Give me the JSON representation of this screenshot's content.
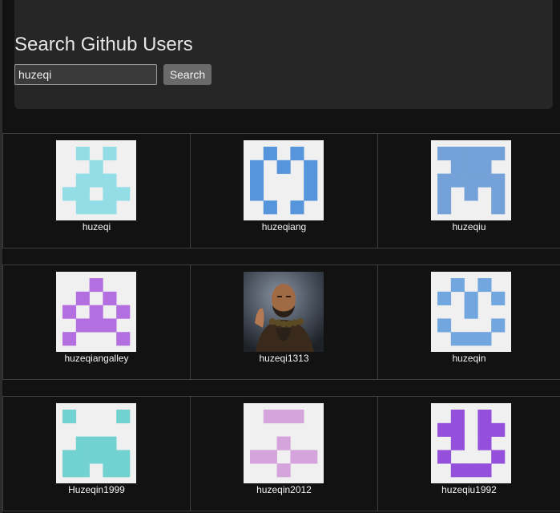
{
  "header": {
    "title": "Search Github Users",
    "search_value": "huzeqi",
    "search_button": "Search"
  },
  "users": [
    {
      "login": "huzeqi",
      "avatar": "identicon",
      "color": "#93dde6",
      "pattern": [
        "01010",
        "00100",
        "01110",
        "11011",
        "01110"
      ]
    },
    {
      "login": "huzeqiang",
      "avatar": "identicon",
      "color": "#5694dc",
      "pattern": [
        "01010",
        "10101",
        "10001",
        "10001",
        "01010"
      ]
    },
    {
      "login": "huzeqiu",
      "avatar": "identicon",
      "color": "#74a2d8",
      "pattern": [
        "11111",
        "01110",
        "11111",
        "10101",
        "10001"
      ]
    },
    {
      "login": "huzeqiangalley",
      "avatar": "identicon",
      "color": "#b36fe0",
      "pattern": [
        "00100",
        "01010",
        "10101",
        "01110",
        "10001"
      ]
    },
    {
      "login": "huzeqi1313",
      "avatar": "photo",
      "color": "#556070",
      "pattern": []
    },
    {
      "login": "huzeqin",
      "avatar": "identicon",
      "color": "#72a6de",
      "pattern": [
        "01010",
        "10101",
        "00100",
        "10001",
        "01110"
      ]
    },
    {
      "login": "Huzeqin1999",
      "avatar": "identicon",
      "color": "#72d2d2",
      "pattern": [
        "10001",
        "00000",
        "01110",
        "11111",
        "11011"
      ]
    },
    {
      "login": "huzeqin2012",
      "avatar": "identicon",
      "color": "#d6a4dc",
      "pattern": [
        "01110",
        "00000",
        "00100",
        "11011",
        "00100"
      ]
    },
    {
      "login": "huzeqiu1992",
      "avatar": "identicon",
      "color": "#9450da",
      "pattern": [
        "01010",
        "11011",
        "01010",
        "10001",
        "01110"
      ]
    }
  ]
}
